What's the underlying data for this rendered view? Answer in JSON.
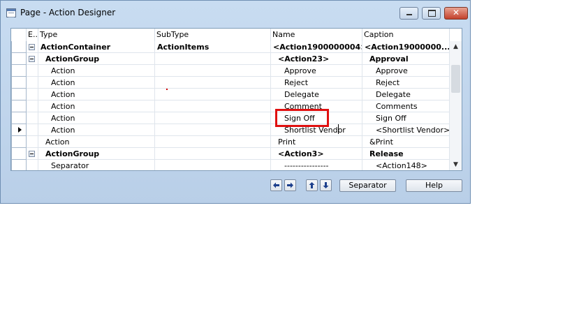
{
  "window": {
    "title": "Page - Action Designer",
    "controls": {
      "minimize": "",
      "maximize": "",
      "close": "✕"
    }
  },
  "grid": {
    "columns": [
      "E..",
      "Type",
      "SubType",
      "Name",
      "Caption"
    ],
    "rows": [
      {
        "selector": "",
        "expand": true,
        "type": "ActionContainer",
        "subtype": "ActionItems",
        "name": "<Action1900000004>",
        "caption": "<Action19000000...",
        "bold": true,
        "indent": 0
      },
      {
        "selector": "",
        "expand": true,
        "type": "ActionGroup",
        "subtype": "",
        "name": "<Action23>",
        "caption": "Approval",
        "bold": true,
        "indent": 1
      },
      {
        "selector": "",
        "expand": false,
        "type": "Action",
        "subtype": "",
        "name": "Approve",
        "caption": "Approve",
        "bold": false,
        "indent": 2
      },
      {
        "selector": "",
        "expand": false,
        "type": "Action",
        "subtype": "",
        "name": "Reject",
        "caption": "Reject",
        "bold": false,
        "indent": 2
      },
      {
        "selector": "",
        "expand": false,
        "type": "Action",
        "subtype": "",
        "name": "Delegate",
        "caption": "Delegate",
        "bold": false,
        "indent": 2
      },
      {
        "selector": "",
        "expand": false,
        "type": "Action",
        "subtype": "",
        "name": "Comment",
        "caption": "Comments",
        "bold": false,
        "indent": 2
      },
      {
        "selector": "",
        "expand": false,
        "type": "Action",
        "subtype": "",
        "name": "Sign Off",
        "caption": "Sign Off",
        "bold": false,
        "indent": 2
      },
      {
        "selector": "current",
        "expand": false,
        "type": "Action",
        "subtype": "",
        "name": "Shortlist Vendor",
        "caption": "<Shortlist Vendor>",
        "bold": false,
        "indent": 2
      },
      {
        "selector": "",
        "expand": false,
        "type": "Action",
        "subtype": "",
        "name": "Print",
        "caption": "&Print",
        "bold": false,
        "indent": 1
      },
      {
        "selector": "",
        "expand": true,
        "type": "ActionGroup",
        "subtype": "",
        "name": "<Action3>",
        "caption": "Release",
        "bold": true,
        "indent": 1
      },
      {
        "selector": "",
        "expand": false,
        "type": "Separator",
        "subtype": "",
        "name": "----------------",
        "caption": "<Action148>",
        "bold": false,
        "indent": 2
      }
    ]
  },
  "buttons": {
    "move_left": "move-left",
    "move_right": "move-right",
    "move_up": "move-up",
    "move_down": "move-down",
    "separator": "Separator",
    "help": "Help"
  },
  "colors": {
    "highlight_border": "#e01010",
    "window_frame": "#b9cfe8"
  }
}
